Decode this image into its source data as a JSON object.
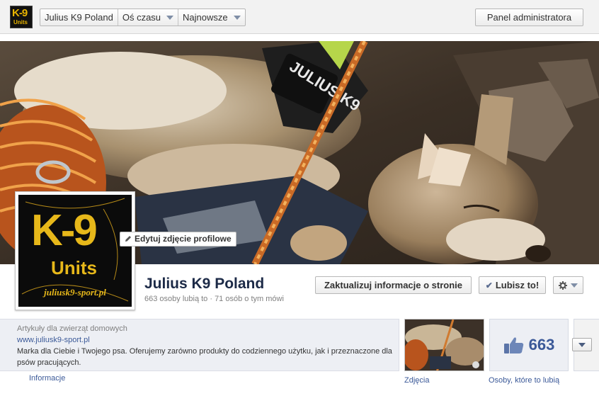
{
  "header": {
    "logo_icon": "k9-units-logo-icon",
    "logo_text": "K-9",
    "logo_subtext": "Units",
    "nav": [
      {
        "label": "Julius K9 Poland",
        "has_dropdown": false
      },
      {
        "label": "Oś czasu",
        "has_dropdown": true
      },
      {
        "label": "Najnowsze",
        "has_dropdown": true
      }
    ],
    "admin_button": "Panel administratora"
  },
  "cover": {
    "image": "dog-sleeping-cover-photo",
    "harness_text": "JULIUS K9"
  },
  "profile": {
    "logo_big": "K-9",
    "logo_units": "Units",
    "logo_url": "juliusk9-sport.pl",
    "edit_photo_label": "Edytuj zdjęcie profilowe"
  },
  "page": {
    "name": "Julius K9 Poland",
    "stats": "663 osoby lubią to · 71 osób o tym mówi",
    "update_info_button": "Zaktualizuj informacje o stronie",
    "like_button": "Lubisz to!",
    "settings_icon": "gear-icon"
  },
  "about": {
    "category": "Artykuły dla zwierząt domowych",
    "website": "www.juliusk9-sport.pl",
    "description": "Marka dla Ciebie i Twojego psa. Oferujemy zarówno produkty do codziennego użytku, jak i przeznaczone dla psów pracujących.",
    "info_link": "Informacje"
  },
  "apps": {
    "photos_label": "Zdjęcia",
    "likes_count": "663",
    "likes_label": "Osoby, które to lubią"
  },
  "colors": {
    "brand_yellow": "#e7b81a",
    "link_blue": "#3b5998",
    "title_navy": "#1c2a47"
  }
}
